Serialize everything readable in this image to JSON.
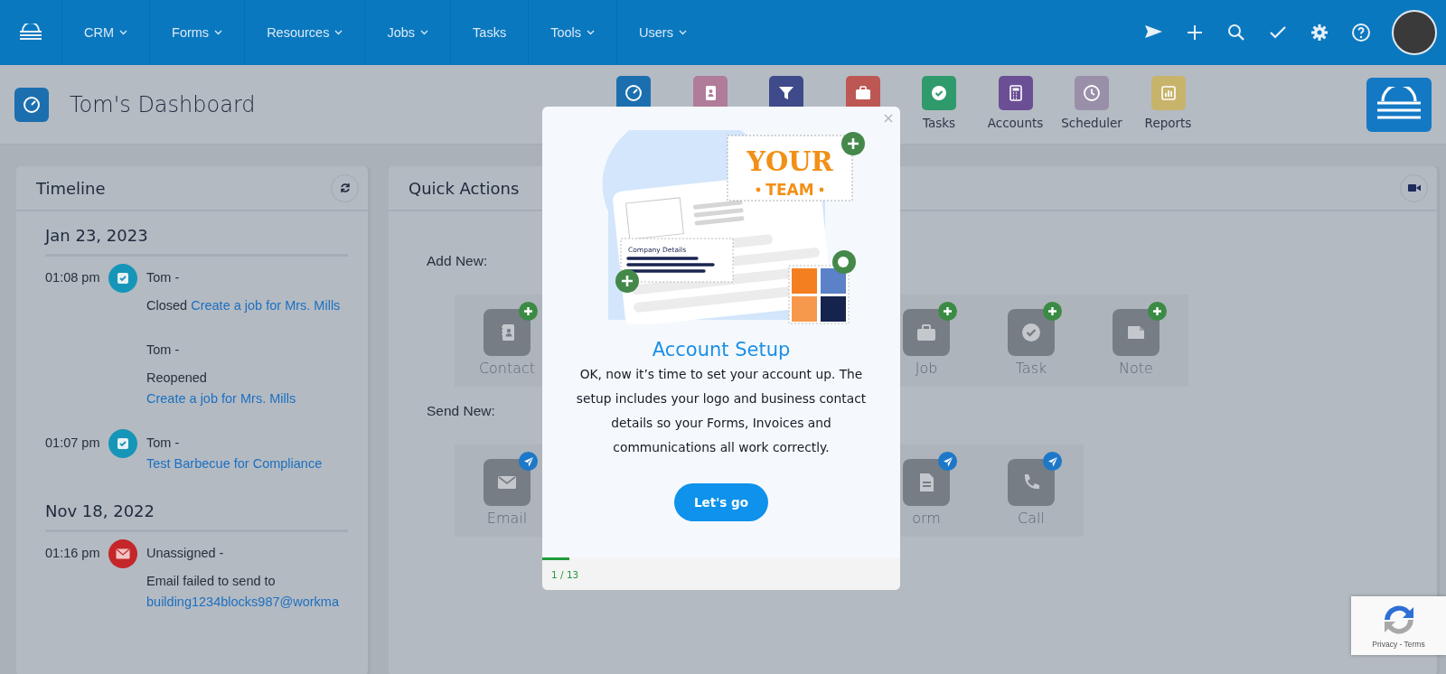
{
  "nav": {
    "items": [
      {
        "label": "CRM",
        "dropdown": true
      },
      {
        "label": "Forms",
        "dropdown": true
      },
      {
        "label": "Resources",
        "dropdown": true
      },
      {
        "label": "Jobs",
        "dropdown": true
      },
      {
        "label": "Tasks",
        "dropdown": false
      },
      {
        "label": "Tools",
        "dropdown": true
      },
      {
        "label": "Users",
        "dropdown": true
      }
    ]
  },
  "header": {
    "title": "Tom's Dashboard",
    "apps": [
      {
        "kind": "dashboard",
        "color": "#1c6fae"
      },
      {
        "kind": "contacts",
        "color": "#b07c99"
      },
      {
        "kind": "filter",
        "color": "#3e4a8a"
      },
      {
        "kind": "jobs",
        "color": "#bd5753"
      },
      {
        "kind": "tasks",
        "label": "Tasks",
        "color": "#2f9a6b"
      },
      {
        "kind": "accounts",
        "label": "Accounts",
        "color": "#6b4f95"
      },
      {
        "kind": "scheduler",
        "label": "Scheduler",
        "color": "#9a8fa8"
      },
      {
        "kind": "reports",
        "label": "Reports",
        "color": "#c8b36b"
      }
    ]
  },
  "timeline": {
    "title": "Timeline",
    "days": [
      {
        "date": "Jan 23, 2023",
        "entries": [
          {
            "time": "01:08 pm",
            "kind": "task",
            "lines": [
              {
                "kind": "author",
                "text": "Tom -"
              },
              {
                "kind": "action",
                "text": "Closed",
                "link": "Create a job for Mrs. Mills"
              },
              {
                "kind": "author",
                "text": "Tom -"
              },
              {
                "kind": "action",
                "text": "Reopened",
                "link": "Create a job for Mrs. Mills"
              }
            ]
          },
          {
            "time": "01:07 pm",
            "kind": "task",
            "lines": [
              {
                "kind": "action",
                "text": "Tom -",
                "link": "Test Barbecue for Compliance"
              }
            ]
          }
        ]
      },
      {
        "date": "Nov 18, 2022",
        "entries": [
          {
            "time": "01:16 pm",
            "kind": "email",
            "lines": [
              {
                "kind": "author",
                "text": "Unassigned -"
              },
              {
                "kind": "action",
                "text": "Email failed to send to"
              },
              {
                "kind": "link",
                "link": "building1234blocks987@workma"
              }
            ]
          }
        ]
      }
    ]
  },
  "quick_actions": {
    "title": "Quick Actions",
    "groups": [
      {
        "label": "Add New:",
        "kind": "add",
        "items": [
          {
            "kind": "contact",
            "label": "Contact"
          },
          {
            "kind": "job",
            "label": "Job"
          },
          {
            "kind": "task",
            "label": "Task"
          },
          {
            "kind": "note",
            "label": "Note"
          }
        ]
      },
      {
        "label": "Send New:",
        "kind": "send",
        "items": [
          {
            "kind": "email",
            "label": "Email"
          },
          {
            "kind": "form",
            "label": "orm"
          },
          {
            "kind": "call",
            "label": "Call"
          }
        ]
      }
    ]
  },
  "modal": {
    "illustration": {
      "headline": "YOUR",
      "subline": "TEAM",
      "card_label": "Company Details"
    },
    "title": "Account Setup",
    "text": "OK, now it’s time to set your account up. The setup includes your logo and business contact details so your Forms, Invoices and communications all work correctly.",
    "button": "Let's go",
    "level": 0.077,
    "step": "1 / 13"
  },
  "recaptcha": {
    "links": "Privacy - Terms"
  }
}
